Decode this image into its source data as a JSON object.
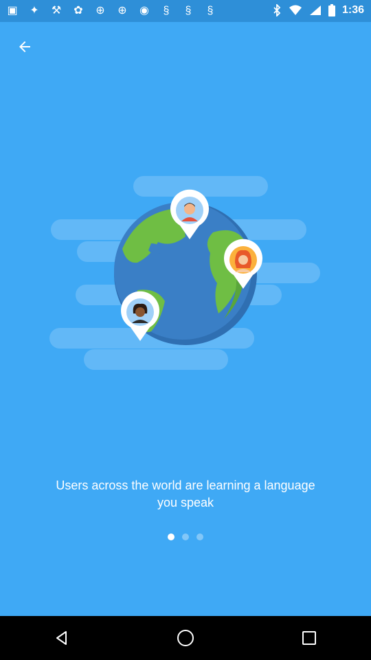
{
  "status_bar": {
    "time": "1:36",
    "left_icons": [
      "app-icon",
      "music-app-icon",
      "wrench-icon",
      "shopping-icon",
      "sf-app-icon",
      "sf-app-icon",
      "notification-icon",
      "s-app-icon",
      "s-app-icon",
      "s-app-icon"
    ],
    "right_icons": [
      "bluetooth-icon",
      "wifi-icon",
      "signal-icon",
      "battery-icon"
    ]
  },
  "onboarding": {
    "message": "Users across the world are learning a language you speak",
    "page_count": 3,
    "current_page": 1
  },
  "colors": {
    "background": "#3fa9f5",
    "status_bar": "#2e8fd8",
    "globe_ocean": "#3a7fc6",
    "globe_land": "#6fbe44"
  }
}
